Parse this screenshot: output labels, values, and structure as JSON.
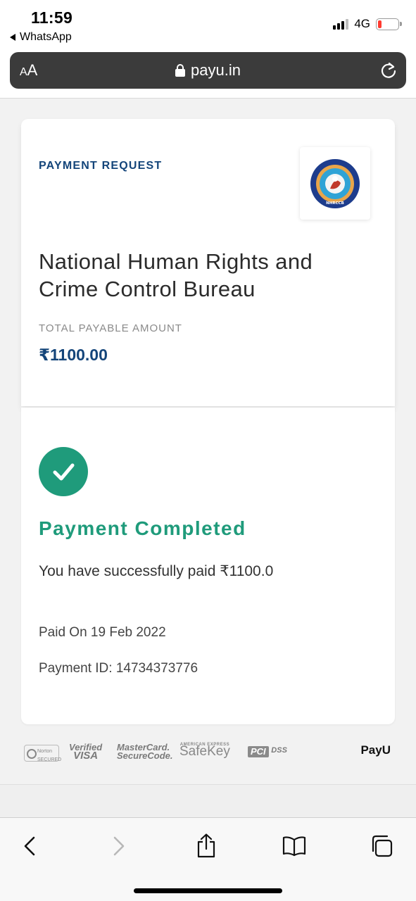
{
  "status_bar": {
    "time": "11:59",
    "back_app": "WhatsApp",
    "network": "4G"
  },
  "browser": {
    "text_size_label_big": "A",
    "text_size_label_small": "A",
    "url": "payu.in"
  },
  "payment_card": {
    "request_label": "PAYMENT REQUEST",
    "merchant_name": "National Human Rights and Crime Control Bureau",
    "total_label": "TOTAL PAYABLE AMOUNT",
    "amount": "₹1100.00",
    "logo_text": "NHRCCB"
  },
  "status_card": {
    "title": "Payment Completed",
    "message": "You have successfully paid ₹1100.0",
    "paid_on": "Paid On 19 Feb 2022",
    "payment_id": "Payment ID: 14734373776"
  },
  "trust_badges": {
    "norton": "Norton SECURED",
    "visa_line1": "Verified",
    "visa_line2": "VISA",
    "mastercard_line1": "MasterCard.",
    "mastercard_line2": "SecureCode.",
    "amex_small": "AMERICAN EXPRESS",
    "safekey": "SafeKey",
    "pci": "PCI",
    "dss": "DSS",
    "payu": "PayU"
  },
  "colors": {
    "brand_blue": "#14457a",
    "success_green": "#1f9b7b",
    "url_bar": "#3b3b3b"
  }
}
